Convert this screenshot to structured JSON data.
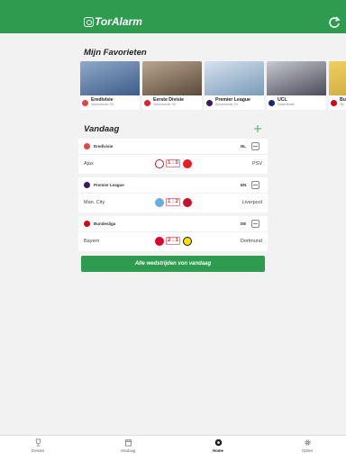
{
  "header": {
    "logo_text": "TorAlarm"
  },
  "favorites": {
    "title": "Mijn Favorieten",
    "cards": [
      {
        "name": "Eredivisie",
        "sub": "Speelronde 29",
        "badge_color": "#e64545",
        "photo_color": "#3d5c8a"
      },
      {
        "name": "Eerste Divisie",
        "sub": "Speelronde 33",
        "badge_color": "#d8262e",
        "photo_color": "#5a4a3a"
      },
      {
        "name": "Premier League",
        "sub": "Speelronde 29",
        "badge_color": "#3d195b",
        "photo_color": "#7a9ab8"
      },
      {
        "name": "UCL",
        "sub": "Kwartfinale",
        "badge_color": "#1a2b6d",
        "photo_color": "#4a4a5a"
      },
      {
        "name": "Bu",
        "sub": "Sp",
        "badge_color": "#d20515",
        "photo_color": "#c8a23a"
      }
    ]
  },
  "today": {
    "title": "Vandaag",
    "matches": [
      {
        "league": "Eredivisie",
        "code": "NL",
        "home": "Ajax",
        "score": "1 : 0",
        "away": "PSV",
        "home_color": "#d2122e",
        "away_color": "#ed1c24",
        "league_color": "#e64545"
      },
      {
        "league": "Premier League",
        "code": "EN",
        "home": "Man. City",
        "score": "1 : 2",
        "away": "Liverpool",
        "home_color": "#6cabdd",
        "away_color": "#c8102e",
        "league_color": "#3d195b"
      },
      {
        "league": "Bundesliga",
        "code": "DE",
        "home": "Bayern",
        "score": "2 : 1",
        "away": "Dortmund",
        "home_color": "#dc052d",
        "away_color": "#fde100",
        "league_color": "#d20515"
      }
    ]
  },
  "cta_label": "Alle wedstrijden von vandaag",
  "tabbar": [
    {
      "label": "Divisies",
      "icon": "trophy-icon"
    },
    {
      "label": "Vandaag",
      "icon": "calendar-icon"
    },
    {
      "label": "Home",
      "icon": "soccer-ball-icon",
      "active": true
    },
    {
      "label": "Opties",
      "icon": "gear-icon"
    }
  ],
  "colors": {
    "brand": "#2e9b4f",
    "score_red": "#d33333",
    "background": "#f2f2f2"
  }
}
